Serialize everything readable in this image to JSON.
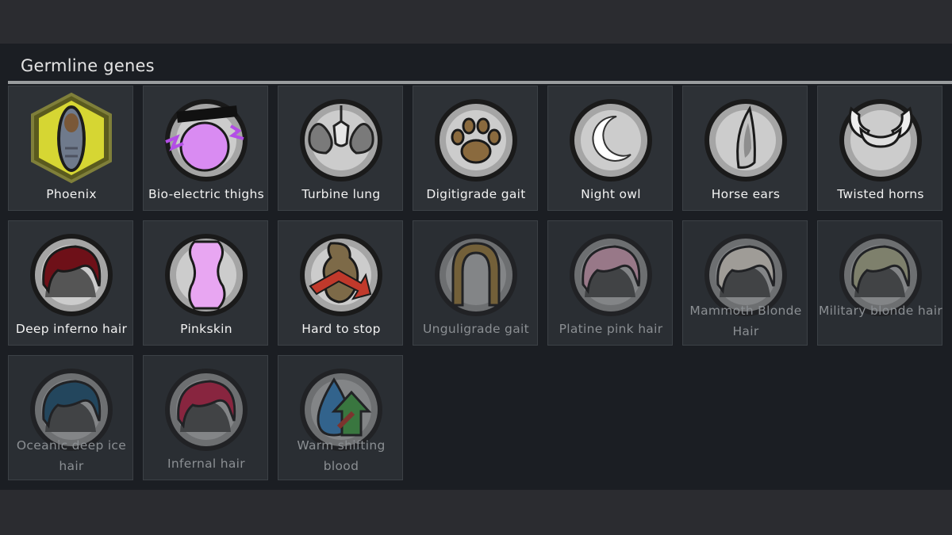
{
  "panel": {
    "title": "Germline genes"
  },
  "genes": [
    {
      "label": "Phoenix",
      "icon": "phoenix-icon",
      "state": "active"
    },
    {
      "label": "Bio-electric thighs",
      "icon": "bio-electric-thighs-icon",
      "state": "active"
    },
    {
      "label": "Turbine lung",
      "icon": "turbine-lung-icon",
      "state": "active"
    },
    {
      "label": "Digitigrade gait",
      "icon": "paw-icon",
      "state": "active"
    },
    {
      "label": "Night owl",
      "icon": "crescent-moon-icon",
      "state": "active"
    },
    {
      "label": "Horse ears",
      "icon": "horse-ear-icon",
      "state": "active"
    },
    {
      "label": "Twisted horns",
      "icon": "twisted-horns-icon",
      "state": "active"
    },
    {
      "label": "Deep inferno hair",
      "icon": "hair-icon",
      "state": "active"
    },
    {
      "label": "Pinkskin",
      "icon": "skin-icon",
      "state": "active"
    },
    {
      "label": "Hard to stop",
      "icon": "hard-to-stop-icon",
      "state": "active"
    },
    {
      "label": "Unguligrade gait",
      "icon": "hoof-icon",
      "state": "inactive"
    },
    {
      "label": "Platine pink hair",
      "icon": "hair-icon",
      "state": "inactive"
    },
    {
      "label": "Mammoth Blonde Hair",
      "icon": "hair-icon",
      "state": "inactive"
    },
    {
      "label": "Military blonde hair",
      "icon": "hair-icon",
      "state": "inactive"
    },
    {
      "label": "Oceanic deep ice hair",
      "icon": "hair-icon",
      "state": "inactive"
    },
    {
      "label": "Infernal hair",
      "icon": "hair-icon",
      "state": "inactive"
    },
    {
      "label": "Warm shifting blood",
      "icon": "blood-drop-arrow-icon",
      "state": "inactive"
    }
  ],
  "colors": {
    "background": "#2b2c30",
    "panel": "#1b1e23",
    "tile": "#2d3136",
    "text_active": "#f2f2f2",
    "text_inactive": "#8b8f93",
    "phoenix_hex": "#d6d633",
    "bio_purple": "#d98bf2",
    "deep_inferno": "#6e1018",
    "pinkskin": "#e8a6f2",
    "platine_pink": "#d3a9a9",
    "mammoth_blonde": "#ddd3c8",
    "military_blonde": "#9a9a7e",
    "oceanic_ice": "#1d4e6e",
    "infernal": "#a8193a"
  }
}
